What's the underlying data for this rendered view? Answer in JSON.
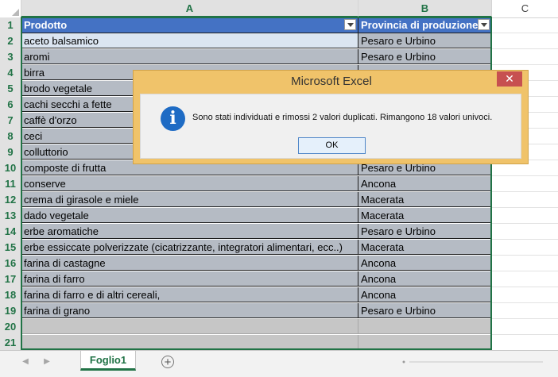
{
  "columns": {
    "a": "A",
    "b": "B",
    "c": "C"
  },
  "header": {
    "col_a": "Prodotto",
    "col_b": "Provincia di produzione"
  },
  "rows": [
    {
      "num": "2",
      "a": "aceto balsamico",
      "b": "Pesaro e Urbino"
    },
    {
      "num": "3",
      "a": "aromi",
      "b": "Pesaro e Urbino"
    },
    {
      "num": "4",
      "a": "birra",
      "b": ""
    },
    {
      "num": "5",
      "a": "brodo vegetale",
      "b": ""
    },
    {
      "num": "6",
      "a": "cachi secchi a fette",
      "b": ""
    },
    {
      "num": "7",
      "a": "caffè d'orzo",
      "b": ""
    },
    {
      "num": "8",
      "a": "ceci",
      "b": ""
    },
    {
      "num": "9",
      "a": "colluttorio",
      "b": ""
    },
    {
      "num": "10",
      "a": "composte di frutta",
      "b": "Pesaro e Urbino"
    },
    {
      "num": "11",
      "a": "conserve",
      "b": "Ancona"
    },
    {
      "num": "12",
      "a": "crema di girasole e miele",
      "b": "Macerata"
    },
    {
      "num": "13",
      "a": "dado vegetale",
      "b": "Macerata"
    },
    {
      "num": "14",
      "a": "erbe aromatiche",
      "b": "Pesaro e Urbino"
    },
    {
      "num": "15",
      "a": "erbe essiccate polverizzate (cicatrizzante, integratori alimentari, ecc..)",
      "b": "Macerata"
    },
    {
      "num": "16",
      "a": "farina di castagne",
      "b": "Ancona"
    },
    {
      "num": "17",
      "a": "farina di farro",
      "b": "Ancona"
    },
    {
      "num": "18",
      "a": "farina di farro e di altri cereali,",
      "b": "Ancona"
    },
    {
      "num": "19",
      "a": "farina di grano",
      "b": "Pesaro e Urbino"
    }
  ],
  "row_numbers": {
    "r1": "1",
    "r20": "20",
    "r21": "21"
  },
  "sheet_tab": "Foglio1",
  "add_sheet": "+",
  "dialog": {
    "title": "Microsoft Excel",
    "close": "✕",
    "icon": "i",
    "message": "Sono stati individuati e rimossi 2 valori duplicati. Rimangono 18 valori univoci.",
    "ok_label": "OK"
  },
  "colors": {
    "header_fill": "#4472c4",
    "selection": "#217346",
    "dialog_frame": "#f0c36a",
    "close_button": "#c75050"
  }
}
